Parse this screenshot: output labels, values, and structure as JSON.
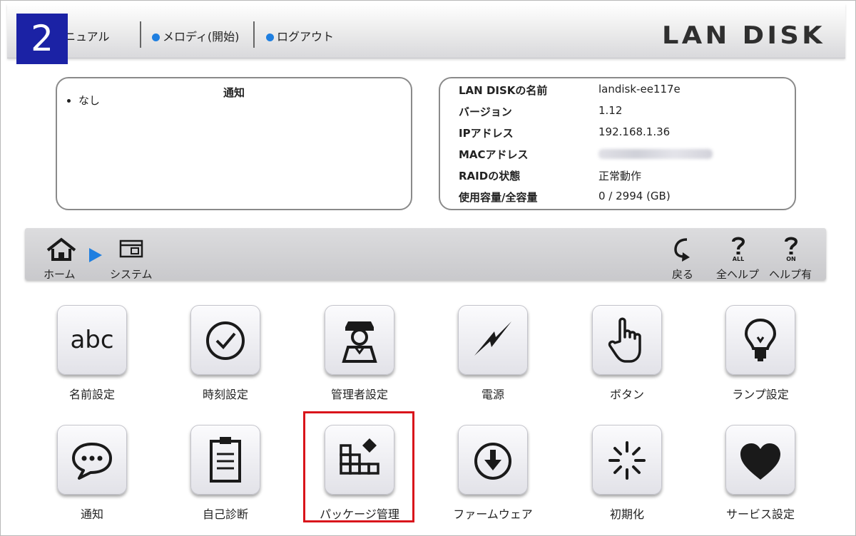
{
  "badge": "2",
  "header": {
    "manual_label": "ニュアル",
    "melody_label": "メロディ(開始)",
    "logout_label": "ログアウト",
    "logo": "LAN DISK",
    "link_dot_color": "#1f7fe0"
  },
  "notice_panel": {
    "title": "通知",
    "items": [
      "なし"
    ]
  },
  "info_panel": {
    "rows": [
      {
        "key": "LAN DISKの名前",
        "value": "landisk-ee117e"
      },
      {
        "key": "バージョン",
        "value": "1.12"
      },
      {
        "key": "IPアドレス",
        "value": "192.168.1.36"
      },
      {
        "key": "MACアドレス",
        "value": ""
      },
      {
        "key": "RAIDの状態",
        "value": "正常動作"
      },
      {
        "key": "使用容量/全容量",
        "value": "0 / 2994 (GB)"
      }
    ]
  },
  "nav": {
    "home": "ホーム",
    "system": "システム",
    "back": "戻る",
    "all_help": "全ヘルプ",
    "help_on": "ヘルプ有",
    "all_help_tag": "ALL",
    "help_on_tag": "ON",
    "arrow_color": "#1f7fe0"
  },
  "tiles": [
    {
      "label": "名前設定",
      "icon": "abc-icon",
      "text": "abc"
    },
    {
      "label": "時刻設定",
      "icon": "clock-icon"
    },
    {
      "label": "管理者設定",
      "icon": "admin-person-icon"
    },
    {
      "label": "電源",
      "icon": "power-lightning-icon"
    },
    {
      "label": "ボタン",
      "icon": "pointing-hand-icon"
    },
    {
      "label": "ランプ設定",
      "icon": "light-bulb-icon"
    },
    {
      "label": "通知",
      "icon": "speech-bubble-icon"
    },
    {
      "label": "自己診断",
      "icon": "clipboard-icon"
    },
    {
      "label": "パッケージ管理",
      "icon": "package-grid-icon"
    },
    {
      "label": "ファームウェア",
      "icon": "download-circle-icon"
    },
    {
      "label": "初期化",
      "icon": "spinner-burst-icon"
    },
    {
      "label": "サービス設定",
      "icon": "heart-icon"
    }
  ],
  "highlight_color": "#d9141b"
}
